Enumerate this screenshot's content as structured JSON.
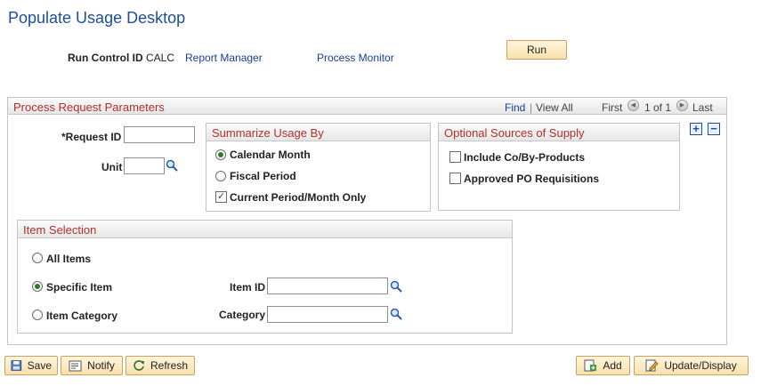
{
  "page": {
    "title": "Populate Usage Desktop"
  },
  "header": {
    "run_control_label": "Run Control ID",
    "run_control_value": "CALC",
    "report_manager": "Report Manager",
    "process_monitor": "Process Monitor",
    "run_label": "Run"
  },
  "params": {
    "title": "Process Request Parameters",
    "find": "Find",
    "view_all": "View All",
    "first": "First",
    "pager": "1 of 1",
    "last": "Last",
    "request_id_label": "*Request ID",
    "request_id_value": "",
    "unit_label": "Unit",
    "unit_value": ""
  },
  "summarize": {
    "title": "Summarize Usage By",
    "calendar_month": "Calendar Month",
    "fiscal_period": "Fiscal Period",
    "current_only": "Current Period/Month Only",
    "selected": "calendar_month",
    "current_only_checked": true
  },
  "supply": {
    "title": "Optional Sources of Supply",
    "co_products": "Include Co/By-Products",
    "po_requisitions": "Approved PO Requisitions"
  },
  "item_selection": {
    "title": "Item Selection",
    "all_items": "All Items",
    "specific_item": "Specific Item",
    "item_category": "Item Category",
    "item_id_label": "Item ID",
    "item_id_value": "",
    "category_label": "Category",
    "category_value": "",
    "selected": "specific_item"
  },
  "toolbar": {
    "save": "Save",
    "notify": "Notify",
    "refresh": "Refresh",
    "add": "Add",
    "update_display": "Update/Display"
  },
  "colors": {
    "title_blue": "#1f4e9b",
    "header_red": "#b0302a",
    "button_face": "#f8e1ad"
  }
}
